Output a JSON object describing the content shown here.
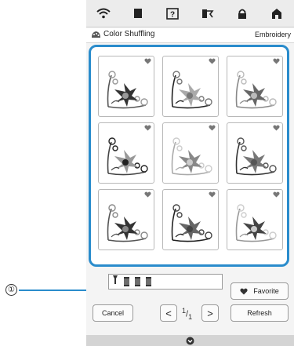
{
  "header": {
    "title": "Color Shuffling",
    "mode": "Embroidery",
    "icons": [
      "wifi-icon",
      "page-icon",
      "help-icon",
      "thread-icon",
      "lock-icon",
      "home-icon"
    ]
  },
  "thumbnails": [
    {
      "id": 1,
      "favorite_icon": "heart-icon"
    },
    {
      "id": 2,
      "favorite_icon": "heart-icon"
    },
    {
      "id": 3,
      "favorite_icon": "heart-icon"
    },
    {
      "id": 4,
      "favorite_icon": "heart-icon"
    },
    {
      "id": 5,
      "favorite_icon": "heart-icon"
    },
    {
      "id": 6,
      "favorite_icon": "heart-icon"
    },
    {
      "id": 7,
      "favorite_icon": "heart-icon"
    },
    {
      "id": 8,
      "favorite_icon": "heart-icon"
    },
    {
      "id": 9,
      "favorite_icon": "heart-icon"
    }
  ],
  "controls": {
    "favorite_label": "Favorite",
    "cancel_label": "Cancel",
    "refresh_label": "Refresh",
    "prev_glyph": "<",
    "next_glyph": ">",
    "page_current": "1",
    "page_total": "1"
  },
  "callout": {
    "number": "①"
  },
  "colors": {
    "accent": "#2a8ccc"
  }
}
